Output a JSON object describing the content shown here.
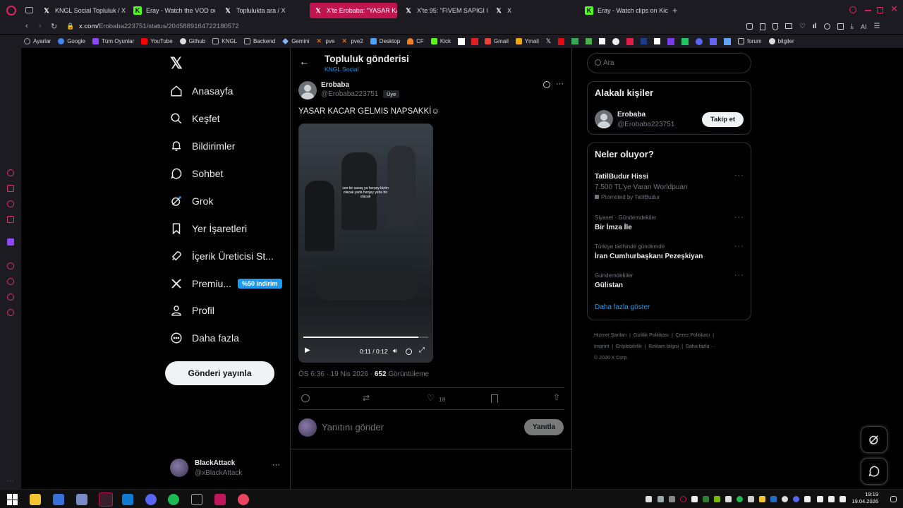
{
  "browser": {
    "tabs": [
      {
        "title": "KNGL Social Topluluk / X",
        "icon": "x-icon"
      },
      {
        "title": "Eray - Watch the VOD on K",
        "icon": "kick-icon"
      },
      {
        "title": "Toplulukta ara / X",
        "icon": "x-icon"
      },
      {
        "title": "X'te Erobaba: \"YASAR KACAR",
        "icon": "x-icon"
      },
      {
        "title": "X'te 95: \"FIVEM SAPIGI M",
        "icon": "x-icon"
      },
      {
        "title": "X",
        "icon": "x-icon"
      },
      {
        "title": "Eray - Watch clips on Kick",
        "icon": "kick-icon"
      }
    ],
    "url_host": "x.com/",
    "url_path": "Erobaba223751/status/2045889164722180572",
    "ai_label": "AI",
    "bookmarks": [
      "Ayarlar",
      "Google",
      "Tüm Oyunlar",
      "YouTube",
      "Github",
      "KNGL",
      "Backend",
      "Gemini",
      "pve",
      "pve2",
      "Desktop",
      "CF",
      "Kick",
      "Gmail",
      "Ymail",
      "forum",
      "bilgiler"
    ],
    "colors": {
      "accent": "#c0164f",
      "chrome": "#1c1b22"
    }
  },
  "sidebar": {
    "items": [
      {
        "label": "Anasayfa",
        "icon": "home-icon"
      },
      {
        "label": "Keşfet",
        "icon": "search-icon"
      },
      {
        "label": "Bildirimler",
        "icon": "bell-icon"
      },
      {
        "label": "Sohbet",
        "icon": "chat-icon"
      },
      {
        "label": "Grok",
        "icon": "grok-icon"
      },
      {
        "label": "Yer İşaretleri",
        "icon": "bookmark-icon"
      },
      {
        "label": "İçerik Üreticisi St...",
        "icon": "rocket-icon"
      },
      {
        "label": "Premiu...",
        "icon": "x-icon"
      },
      {
        "label": "Profil",
        "icon": "person-icon"
      },
      {
        "label": "Daha fazla",
        "icon": "more-circle-icon"
      }
    ],
    "premium_badge": "%50 indirim",
    "post_button": "Gönderi yayınla",
    "account": {
      "name": "BlackAttack",
      "handle": "@xBlackAttack"
    }
  },
  "header": {
    "title": "Topluluk gönderisi",
    "subtitle": "KNGL Social"
  },
  "tweet": {
    "author_name": "Erobaba",
    "author_handle": "@Erobaba223751",
    "badge": "Üye",
    "text": "YASAR KACAR GELMIS NAPSAKKİ☺",
    "video_caption": "son bir savaş ya herşey bizim olacak yada herşey yerle bir olacak",
    "video_time": "0:11 / 0:12",
    "video_progress": 0.92,
    "timestamp": "ÖS 6:36 · 19 Nis 2026 · ",
    "views_count": "652",
    "views_label": "Görüntüleme",
    "likes": "18",
    "reply_placeholder": "Yanıtını gönder",
    "reply_button": "Yanıtla"
  },
  "right": {
    "search_placeholder": "Ara",
    "related_title": "Alakalı kişiler",
    "related_name": "Erobaba",
    "related_handle": "@Erobaba223751",
    "follow_button": "Takip et",
    "trends_title": "Neler oluyor?",
    "promo": {
      "title": "TatilBudur Hissi",
      "subtitle": "7.500 TL'ye Varan Worldpuan",
      "promoted": "Promoted by TatilBudur"
    },
    "trends": [
      {
        "context": "Siyaset · Gündemdekiler",
        "title": "Bir İmza İle"
      },
      {
        "context": "Türkiye tarihinde gündemde",
        "title": "İran Cumhurbaşkanı Pezeşkiyan"
      },
      {
        "context": "Gündemdekiler",
        "title": "Gülistan"
      }
    ],
    "show_more": "Daha fazla göster",
    "footer": [
      "Hizmet Şartları",
      "Gizlilik Politikası",
      "Çerez Politikası",
      "Imprint",
      "Erişilebilirlik",
      "Reklam bilgisi",
      "Daha fazla ···",
      "© 2026 X Corp."
    ]
  },
  "taskbar": {
    "time": "19:19",
    "date": "19.04.2026"
  }
}
